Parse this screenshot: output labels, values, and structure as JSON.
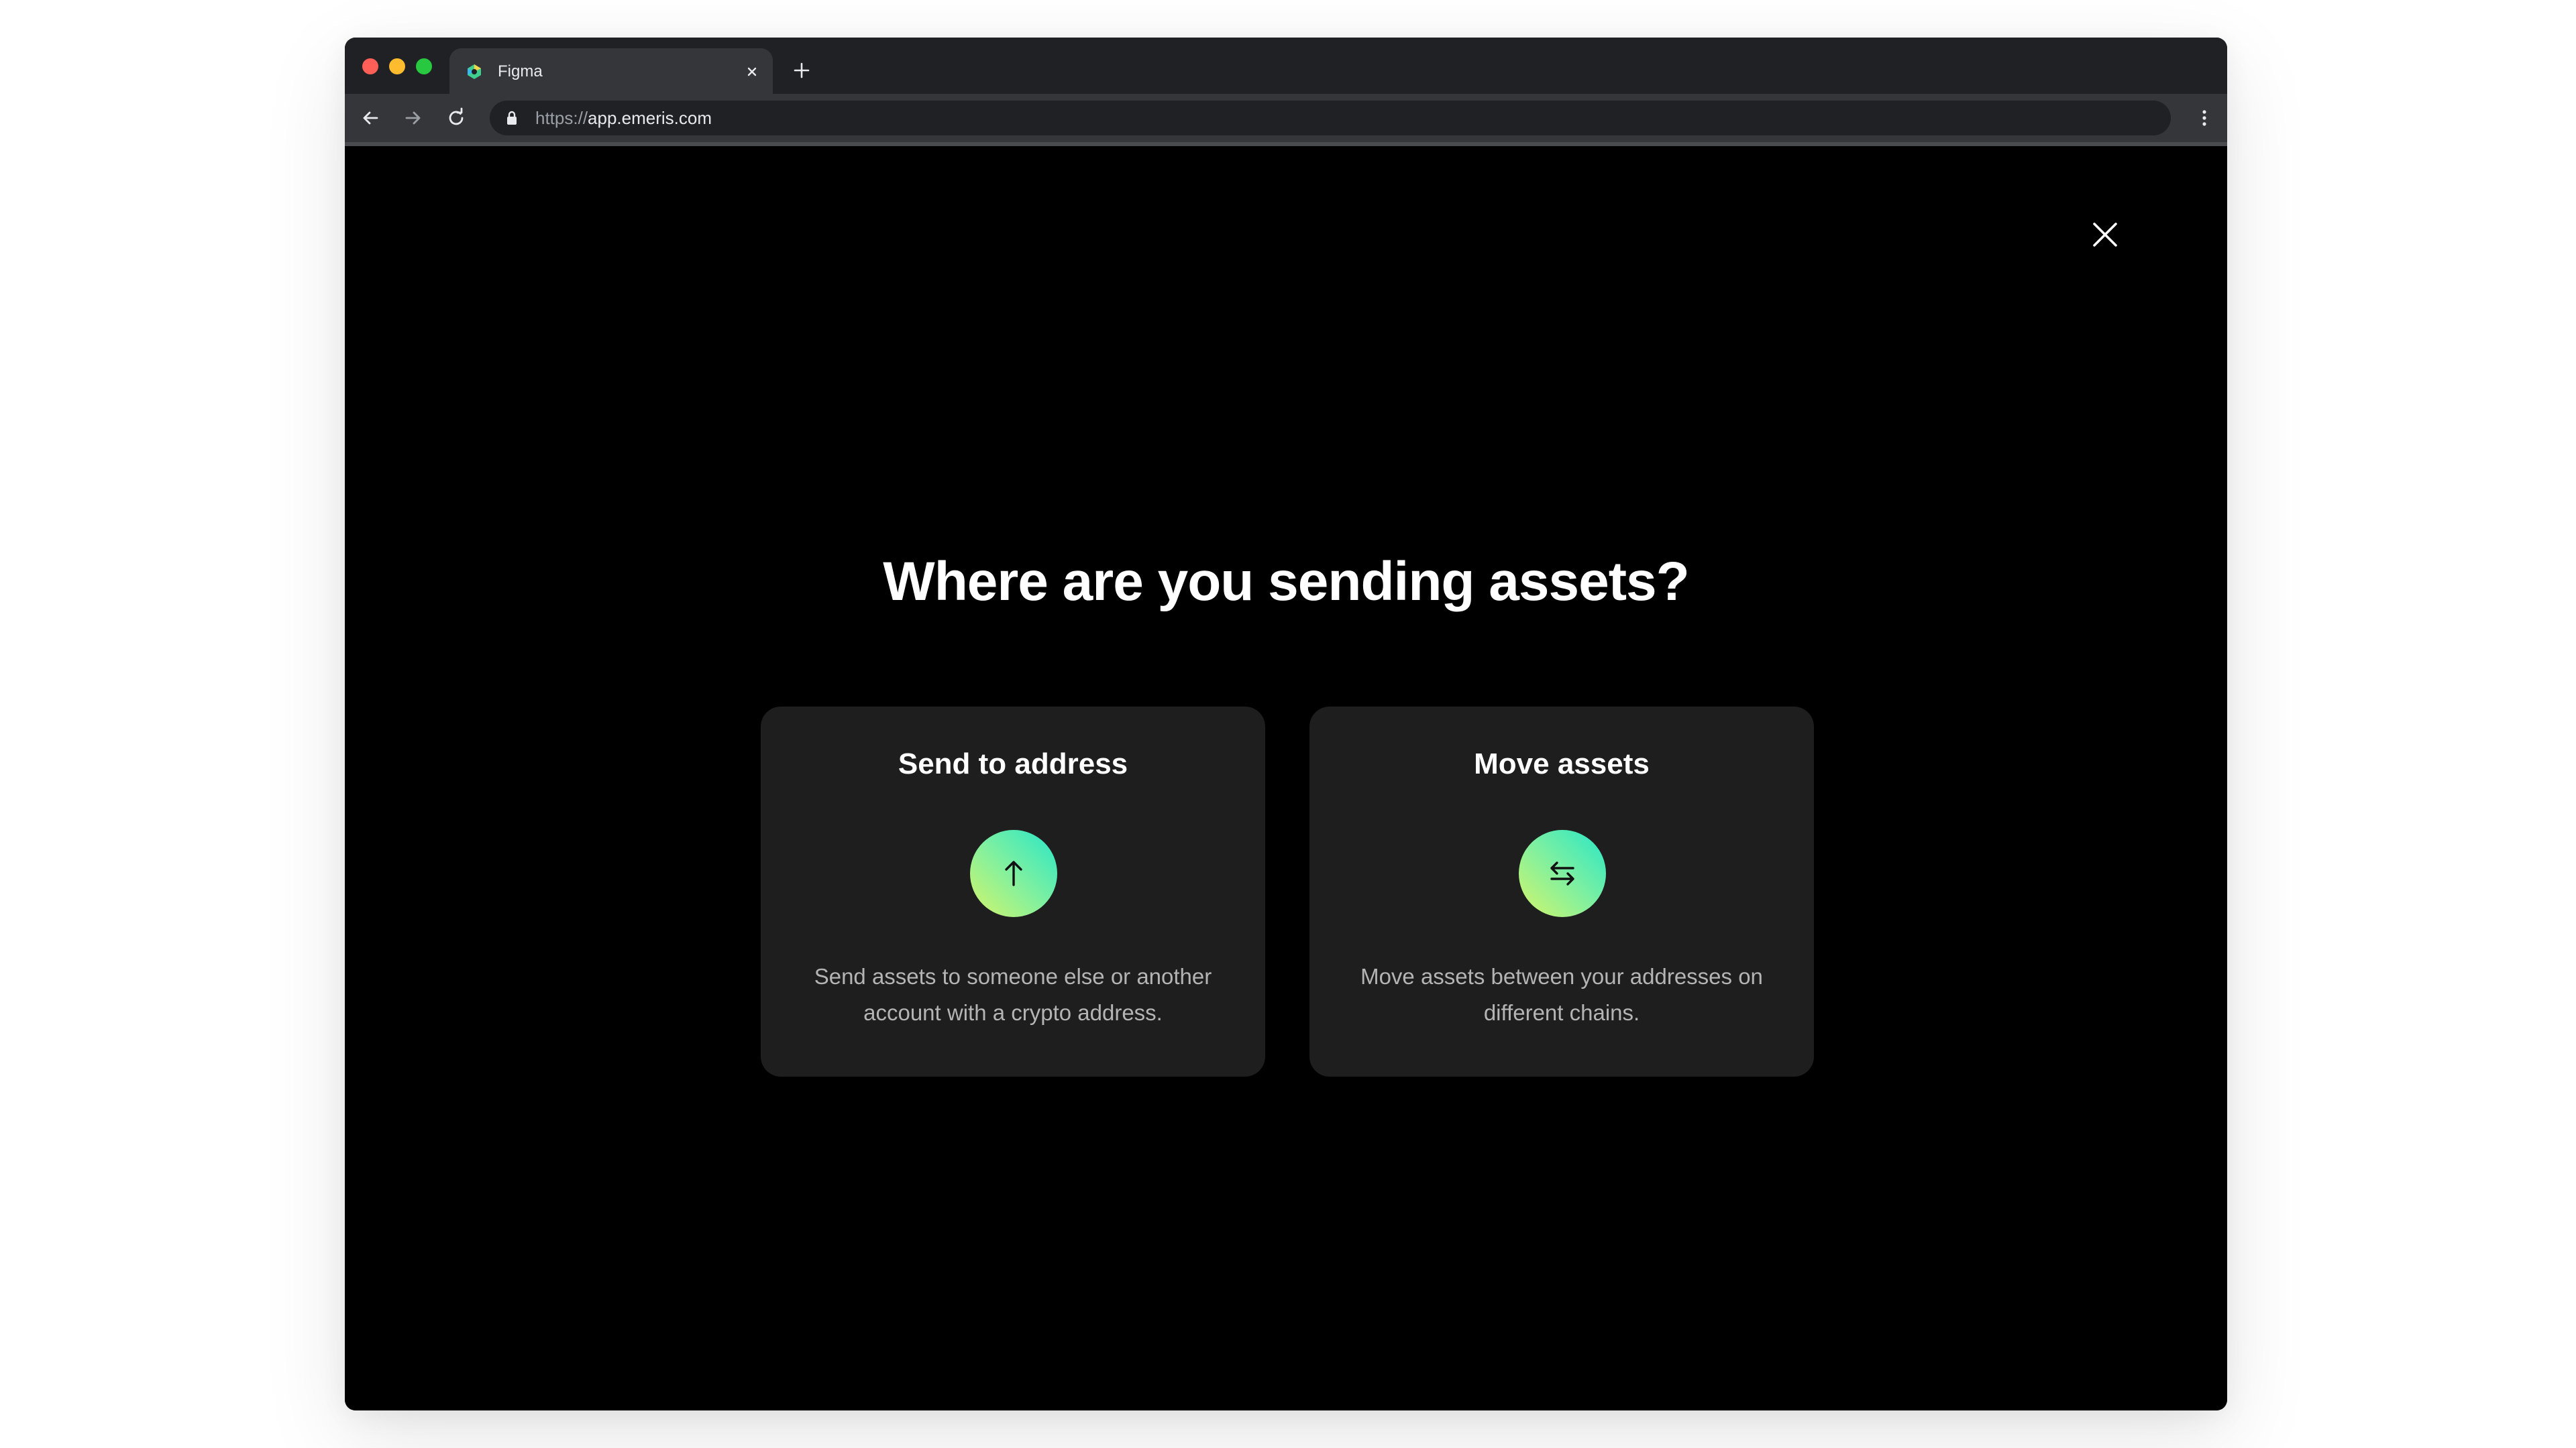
{
  "browser": {
    "tab": {
      "title": "Figma",
      "favicon": "figma-favicon-icon"
    },
    "address_bar": {
      "scheme": "https://",
      "host": "app.emeris.com",
      "lock_icon": "lock-icon"
    },
    "icons": {
      "back": "arrow-left-icon",
      "forward": "arrow-right-icon",
      "reload": "reload-icon",
      "menu": "kebab-menu-icon",
      "new_tab": "plus-icon",
      "tab_close": "close-icon"
    }
  },
  "modal": {
    "title": "Where are you sending assets?",
    "close_icon": "close-icon",
    "options": [
      {
        "title": "Send to address",
        "icon": "arrow-up-icon",
        "description": "Send assets to someone else or another account with a crypto address."
      },
      {
        "title": "Move assets",
        "icon": "swap-arrows-icon",
        "description": "Move assets between your addresses on different chains."
      }
    ]
  },
  "colors": {
    "page_background": "#000000",
    "card_background": "#1e1e1e",
    "gradient_start": "#d5f56a",
    "gradient_end": "#27e6c8",
    "chrome_dark": "#202124",
    "chrome_tab": "#35363a"
  }
}
